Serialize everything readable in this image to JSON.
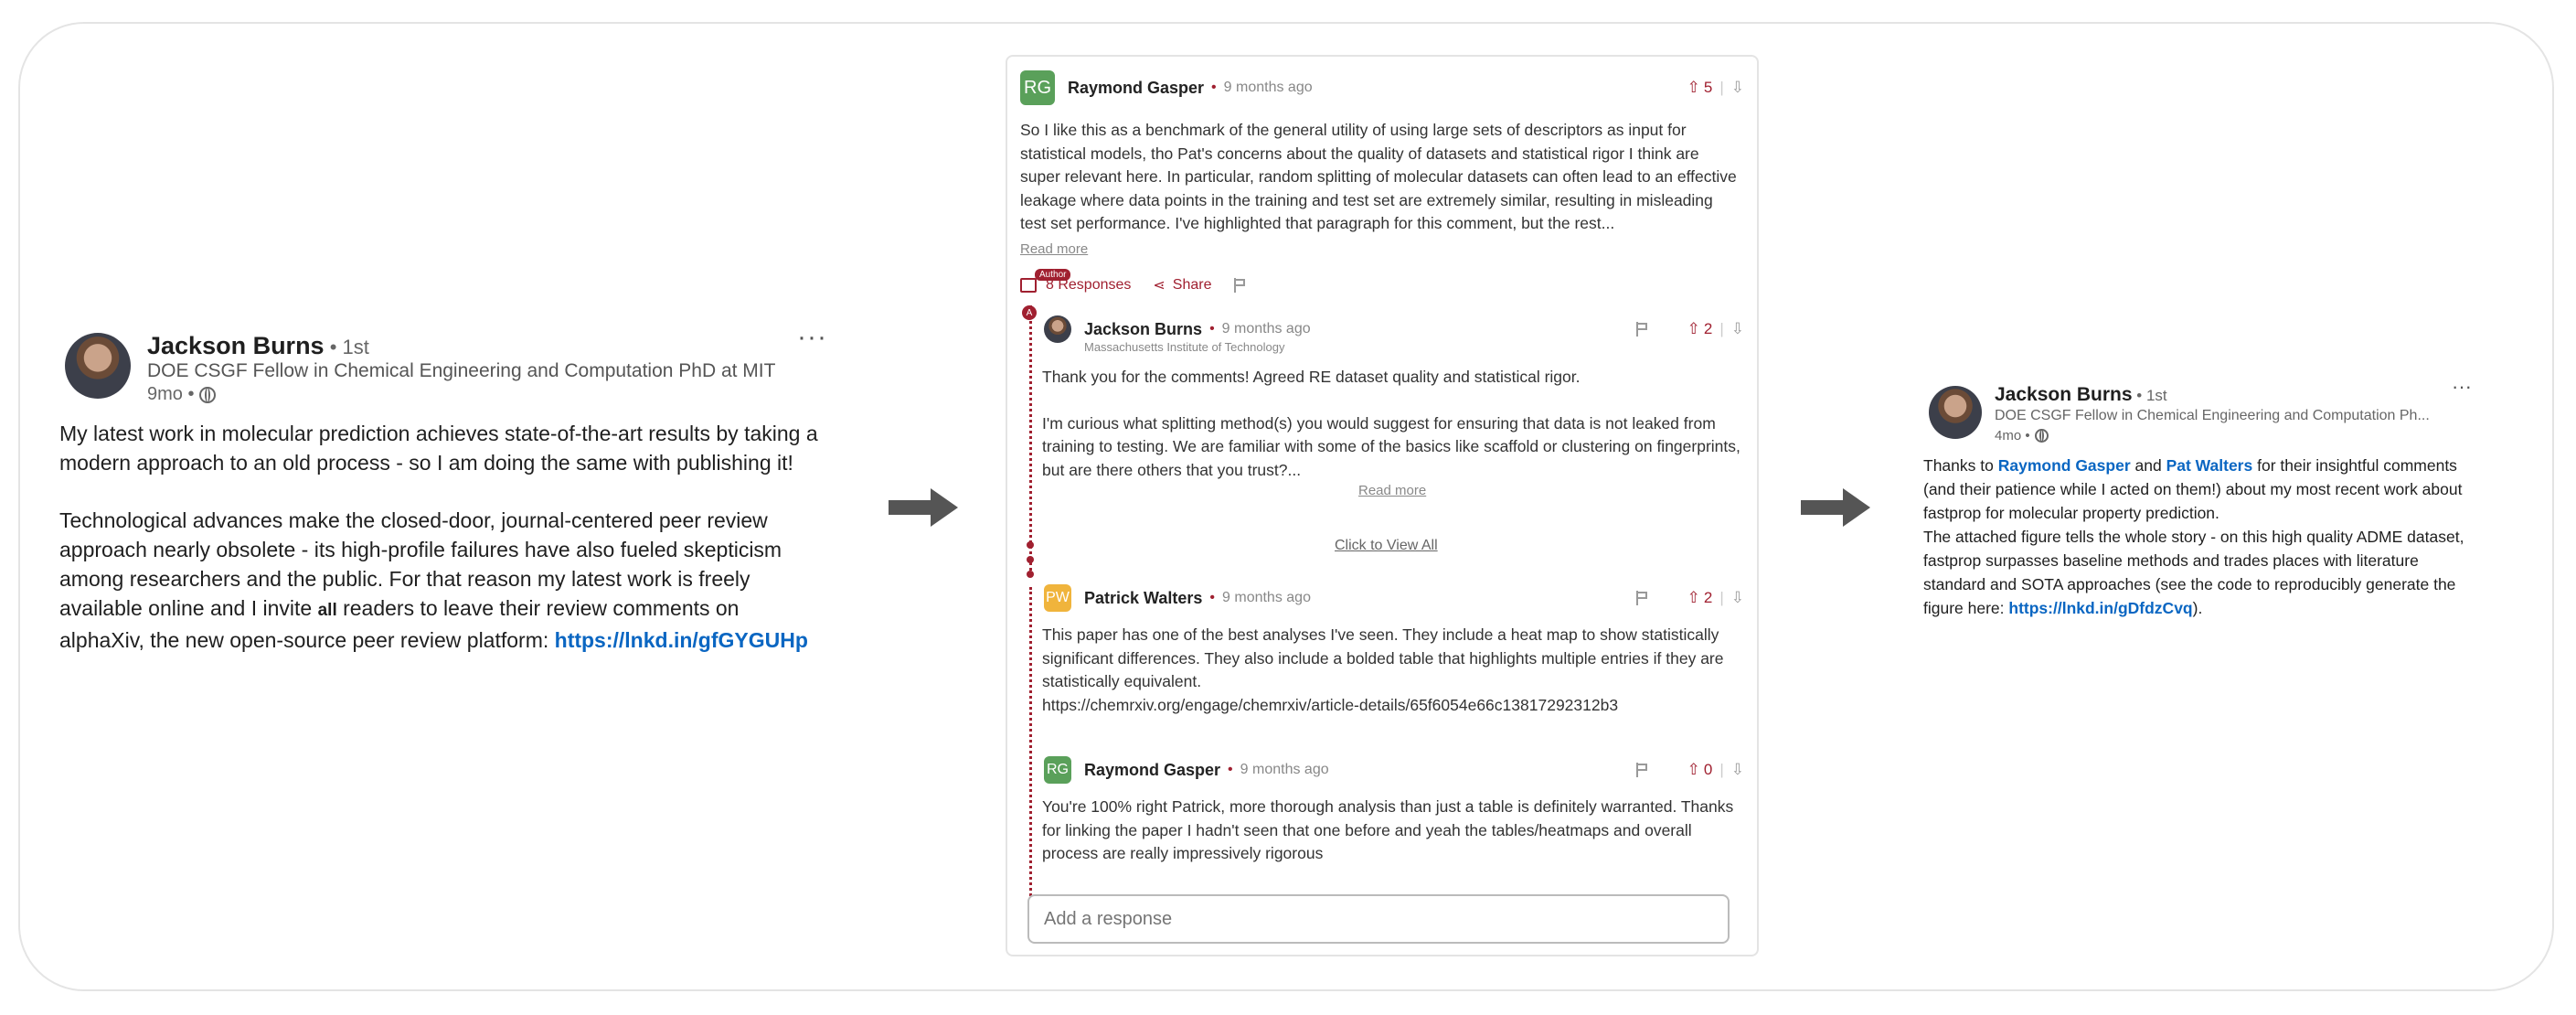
{
  "left_post": {
    "name": "Jackson Burns",
    "degree": " • 1st",
    "subtitle": "DOE CSGF Fellow in Chemical Engineering and Computation PhD at MIT",
    "time": "9mo •",
    "more": "···",
    "p1": "My latest work in molecular prediction achieves state-of-the-art results by taking a modern approach to an old process - so I am doing the same with publishing it!",
    "p2_a": "Technological advances make the closed-door, journal-centered peer review approach nearly obsolete - its high-profile failures have also fueled skepticism among researchers and the public. For that reason my latest work is freely available online and I invite ",
    "p2_all": "all",
    "p2_b": " readers to leave their review comments on alphaXiv, the new open-source peer review platform: ",
    "link": "https://lnkd.in/gfGYGUHp"
  },
  "panel": {
    "c1": {
      "initials": "RG",
      "name": "Raymond Gasper",
      "time": "9 months ago",
      "votes": "5",
      "text": "So I like this as a benchmark of the general utility of using large sets of descriptors as input for statistical models, tho Pat's concerns about the quality of datasets and statistical rigor I think are super relevant here. In particular, random splitting of molecular datasets can often lead to an effective leakage where data points in the training and test set are extremely similar, resulting in misleading test set performance. I've highlighted that paragraph for this comment, but the rest...",
      "read_more": "Read more",
      "author_badge": "Author",
      "responses": "8 Responses",
      "share": "Share"
    },
    "c2": {
      "name": "Jackson Burns",
      "time": "9 months ago",
      "affiliation": "Massachusetts Institute of Technology",
      "votes": "2",
      "p1": "Thank you for the comments! Agreed RE dataset quality and statistical rigor.",
      "p2": "I'm curious what splitting method(s) you would suggest for ensuring that data is not leaked from training to testing. We are familiar with some of the basics like scaffold or clustering on fingerprints, but are there others that you trust?...",
      "read_more": "Read more"
    },
    "view_all": "Click to View All",
    "c3": {
      "initials": "PW",
      "name": "Patrick Walters",
      "time": "9 months ago",
      "votes": "2",
      "text": "This paper has one of the best analyses I've seen. They include a heat map to show statistically significant differences. They also include a bolded table that highlights multiple entries if they are statistically equivalent.",
      "url": "https://chemrxiv.org/engage/chemrxiv/article-details/65f6054e66c13817292312b3"
    },
    "c4": {
      "initials": "RG",
      "name": "Raymond Gasper",
      "time": "9 months ago",
      "votes": "0",
      "text": "You're 100% right Patrick, more thorough analysis than just a table is definitely warranted. Thanks for linking the paper I hadn't seen that one before and yeah the tables/heatmaps and overall process are really impressively rigorous"
    },
    "reply_placeholder": "Add a response"
  },
  "right_post": {
    "name": "Jackson Burns",
    "degree": " • 1st",
    "subtitle": "DOE CSGF Fellow in Chemical Engineering and Computation Ph...",
    "time": "4mo •",
    "more": "···",
    "t1": "Thanks to ",
    "mention1": "Raymond Gasper",
    "t2": " and ",
    "mention2": "Pat Walters",
    "t3": " for their insightful comments (and their patience while I acted on them!) about my most recent work about fastprop for molecular property prediction.",
    "t4": "The attached figure tells the whole story - on this high quality ADME dataset, fastprop surpasses baseline methods and trades places with literature standard and SOTA approaches (see the code to reproducibly generate the figure here: ",
    "link": "https://lnkd.in/gDfdzCvq",
    "t5": ")."
  },
  "colors": {
    "accent": "#a02030",
    "link": "#0a66c2",
    "rg_avatar": "#5aa05a",
    "pw_avatar": "#f0b43c"
  },
  "icons": [
    "globe-icon",
    "more-icon",
    "upvote-icon",
    "downvote-icon",
    "flag-icon",
    "share-icon",
    "comment-icon",
    "arrow-right-icon"
  ]
}
